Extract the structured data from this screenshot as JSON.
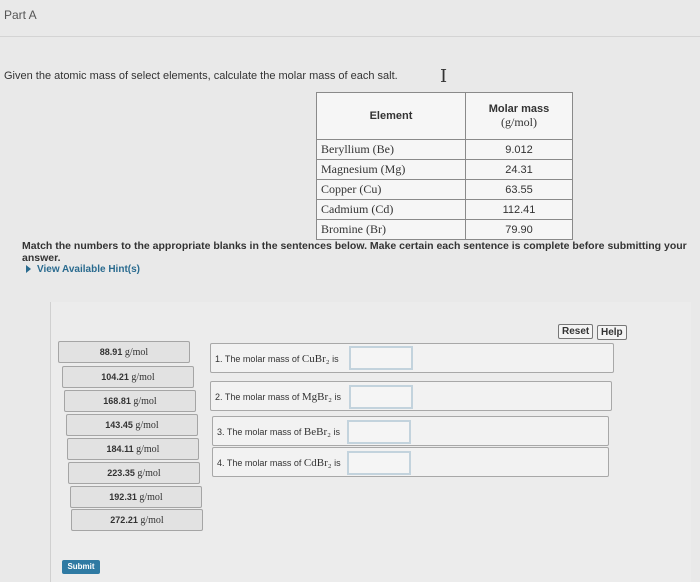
{
  "part_title": "Part A",
  "question": "Given the atomic mass of select elements, calculate the molar mass of each salt.",
  "table": {
    "col_element": "Element",
    "col_mass": "Molar mass",
    "col_mass_unit": "(g/mol)",
    "rows": [
      {
        "element": "Beryllium (Be)",
        "mass": "9.012"
      },
      {
        "element": "Magnesium (Mg)",
        "mass": "24.31"
      },
      {
        "element": "Copper (Cu)",
        "mass": "63.55"
      },
      {
        "element": "Cadmium (Cd)",
        "mass": "112.41"
      },
      {
        "element": "Bromine (Br)",
        "mass": "79.90"
      }
    ]
  },
  "instructions": "Match the numbers to the appropriate blanks in the sentences below. Make certain each sentence is complete before submitting your answer.",
  "hint_label": "View Available Hint(s)",
  "reset_label": "Reset",
  "help_label": "Help",
  "unit": "g/mol",
  "chips": [
    "88.91",
    "104.21",
    "168.81",
    "143.45",
    "184.11",
    "223.35",
    "192.31",
    "272.21"
  ],
  "sentences": [
    {
      "prefix": "1. The molar mass of",
      "formula": "CuBr₂",
      "suffix": "is"
    },
    {
      "prefix": "2. The molar mass of",
      "formula": "MgBr₂",
      "suffix": "is"
    },
    {
      "prefix": "3. The molar mass of",
      "formula": "BeBr₂",
      "suffix": "is"
    },
    {
      "prefix": "4. The molar mass of",
      "formula": "CdBr₂",
      "suffix": "is"
    }
  ],
  "submit_label": "Submit"
}
